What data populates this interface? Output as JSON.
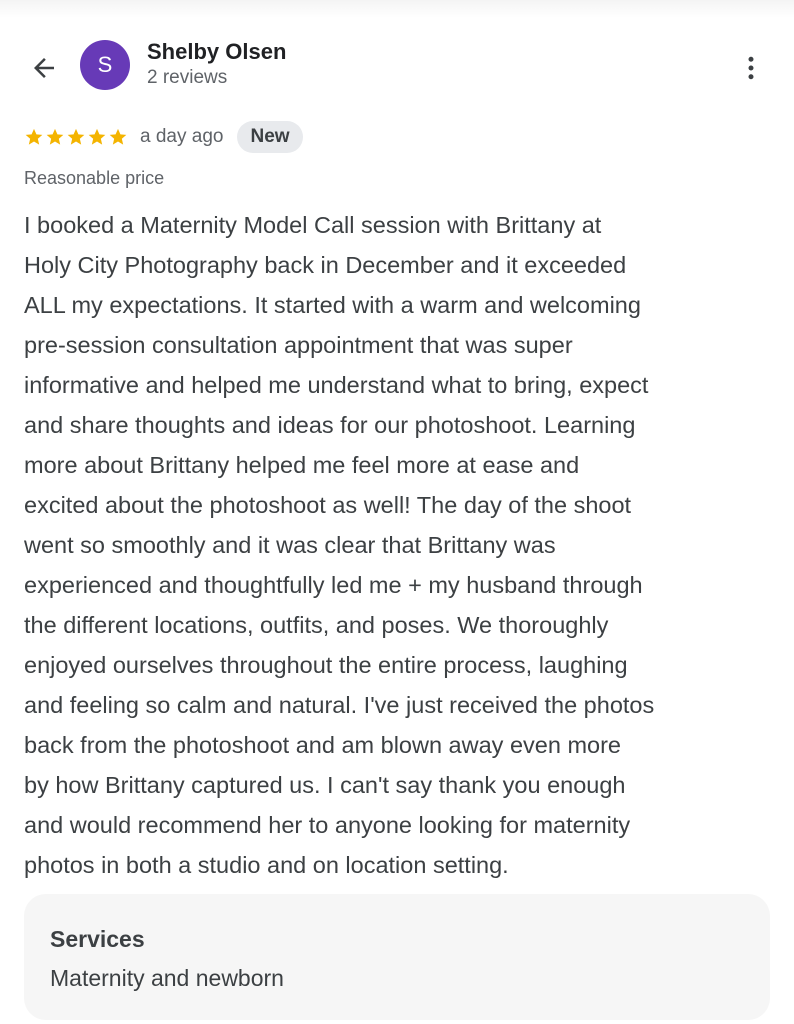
{
  "colors": {
    "avatar_bg": "#673ab7",
    "star": "#f4b400",
    "text_primary": "#202124",
    "text_body": "#3c4043",
    "text_secondary": "#5f6368",
    "badge_bg": "#e8eaed",
    "card_bg": "#f6f6f6"
  },
  "header": {
    "back_icon": "arrow-back-icon",
    "avatar_initial": "S",
    "reviewer_name": "Shelby Olsen",
    "reviewer_count": "2 reviews",
    "more_icon": "more-vert-icon"
  },
  "review": {
    "rating": 5,
    "max_rating": 5,
    "time_ago": "a day ago",
    "badge": "New",
    "attribute": "Reasonable price",
    "text": "I booked a Maternity Model Call session with Brittany at\nHoly City Photography back in December and it exceeded\nALL my expectations. It started with a warm and welcoming\npre-session consultation appointment that was super\ninformative and helped me understand what to bring, expect\nand share thoughts and ideas for our photoshoot. Learning\nmore about Brittany helped me feel more at ease and\nexcited about the photoshoot as well! The day of the shoot\nwent so smoothly and it was clear that Brittany was\nexperienced and thoughtfully led me + my husband through\nthe different locations, outfits, and poses. We thoroughly\nenjoyed ourselves throughout the entire process, laughing\nand feeling so calm and natural. I've just received the photos\nback from the photoshoot and am blown away even more\nby how Brittany captured us. I can't say thank you enough\nand would recommend her to anyone looking for maternity\nphotos in both a studio and on location setting."
  },
  "services": {
    "title": "Services",
    "value": "Maternity and newborn"
  }
}
